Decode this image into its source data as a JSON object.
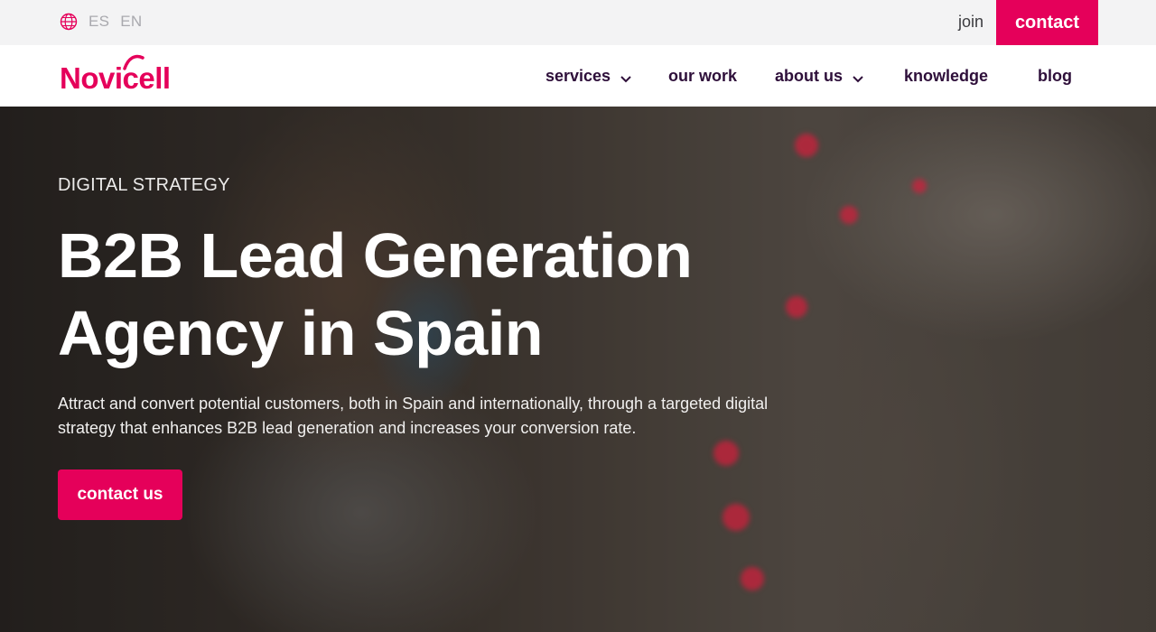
{
  "topbar": {
    "languages": [
      "ES",
      "EN"
    ],
    "join_label": "join",
    "contact_label": "contact"
  },
  "nav": {
    "logo_text": "Novicell",
    "items": [
      {
        "label": "services",
        "has_dropdown": true
      },
      {
        "label": "our work",
        "has_dropdown": false
      },
      {
        "label": "about us",
        "has_dropdown": true
      },
      {
        "label": "knowledge",
        "has_dropdown": false
      },
      {
        "label": "blog",
        "has_dropdown": false
      }
    ]
  },
  "hero": {
    "eyebrow": "DIGITAL STRATEGY",
    "headline": "B2B Lead Generation Agency in Spain",
    "lead": "Attract and convert potential customers, both in Spain and internationally, through a targeted digital strategy that enhances B2B lead generation and increases your conversion rate.",
    "cta_label": "contact us"
  },
  "icons": [
    "globe-icon",
    "chevron-down-icon"
  ],
  "colors": {
    "brand": "#e5005a",
    "nav_text": "#2e0f3a",
    "topbar_bg": "#f3f3f4"
  }
}
